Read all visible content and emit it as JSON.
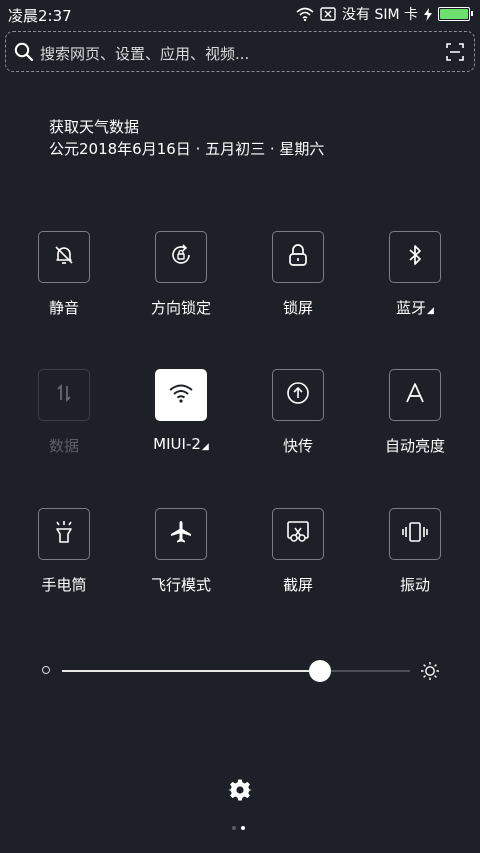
{
  "status_bar": {
    "time": "凌晨2:37",
    "sim_text": "没有 SIM 卡",
    "battery_level": 1.0,
    "battery_color": "#6ee06e"
  },
  "search": {
    "placeholder": "搜索网页、设置、应用、视频..."
  },
  "weather": {
    "title": "获取天气数据",
    "date": "公元2018年6月16日 · 五月初三 · 星期六"
  },
  "tiles": [
    {
      "label": "静音",
      "icon": "bell-off-icon",
      "state": "off"
    },
    {
      "label": "方向锁定",
      "icon": "rotation-lock-icon",
      "state": "off"
    },
    {
      "label": "锁屏",
      "icon": "lock-icon",
      "state": "off"
    },
    {
      "label": "蓝牙",
      "icon": "bluetooth-icon",
      "state": "off",
      "expandable": true
    },
    {
      "label": "数据",
      "icon": "data-arrows-icon",
      "state": "disabled"
    },
    {
      "label": "MIUI-2",
      "icon": "wifi-icon",
      "state": "on",
      "expandable": true
    },
    {
      "label": "快传",
      "icon": "share-upload-icon",
      "state": "off"
    },
    {
      "label": "自动亮度",
      "icon": "auto-brightness-icon",
      "state": "off"
    },
    {
      "label": "手电筒",
      "icon": "flashlight-icon",
      "state": "off"
    },
    {
      "label": "飞行模式",
      "icon": "airplane-icon",
      "state": "off"
    },
    {
      "label": "截屏",
      "icon": "screenshot-icon",
      "state": "off"
    },
    {
      "label": "振动",
      "icon": "vibrate-icon",
      "state": "off"
    }
  ],
  "brightness": {
    "level": 0.74
  },
  "pager": {
    "count": 2,
    "active": 1
  },
  "colors": {
    "background": "#1d2026",
    "tile_border": "#7a7d82",
    "active_tile": "#ffffff"
  }
}
